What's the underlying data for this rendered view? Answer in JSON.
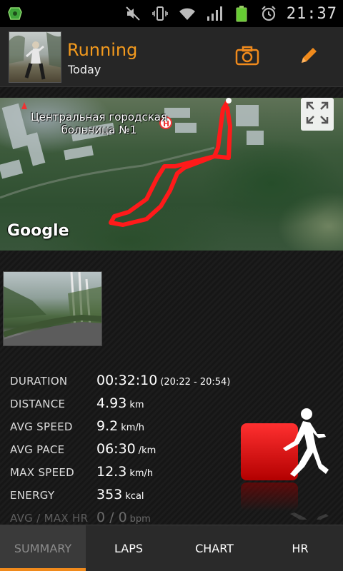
{
  "status_bar": {
    "time": "21:37",
    "icons": [
      "app-icon",
      "mute-icon",
      "vibrate-icon",
      "wifi-icon",
      "signal-icon",
      "battery-icon",
      "alarm-icon"
    ]
  },
  "header": {
    "title": "Running",
    "subtitle": "Today",
    "accent": "#f39a1e"
  },
  "map": {
    "label_line1": "Центральная городская",
    "label_line2": "больница №1",
    "attribution": "Google"
  },
  "stats": [
    {
      "label": "DURATION",
      "value": "00:32:10",
      "unit": "(20:22 - 20:54)"
    },
    {
      "label": "DISTANCE",
      "value": "4.93",
      "unit": "km"
    },
    {
      "label": "AVG SPEED",
      "value": "9.2",
      "unit": "km/h"
    },
    {
      "label": "AVG PACE",
      "value": "06:30",
      "unit": "/km"
    },
    {
      "label": "MAX SPEED",
      "value": "12.3",
      "unit": "km/h"
    },
    {
      "label": "ENERGY",
      "value": "353",
      "unit": "kcal"
    },
    {
      "label": "AVG / MAX HR",
      "value": "0 / 0",
      "unit": "bpm"
    }
  ],
  "tabs": [
    {
      "label": "SUMMARY",
      "active": true
    },
    {
      "label": "LAPS",
      "active": false
    },
    {
      "label": "CHART",
      "active": false
    },
    {
      "label": "HR",
      "active": false
    }
  ]
}
